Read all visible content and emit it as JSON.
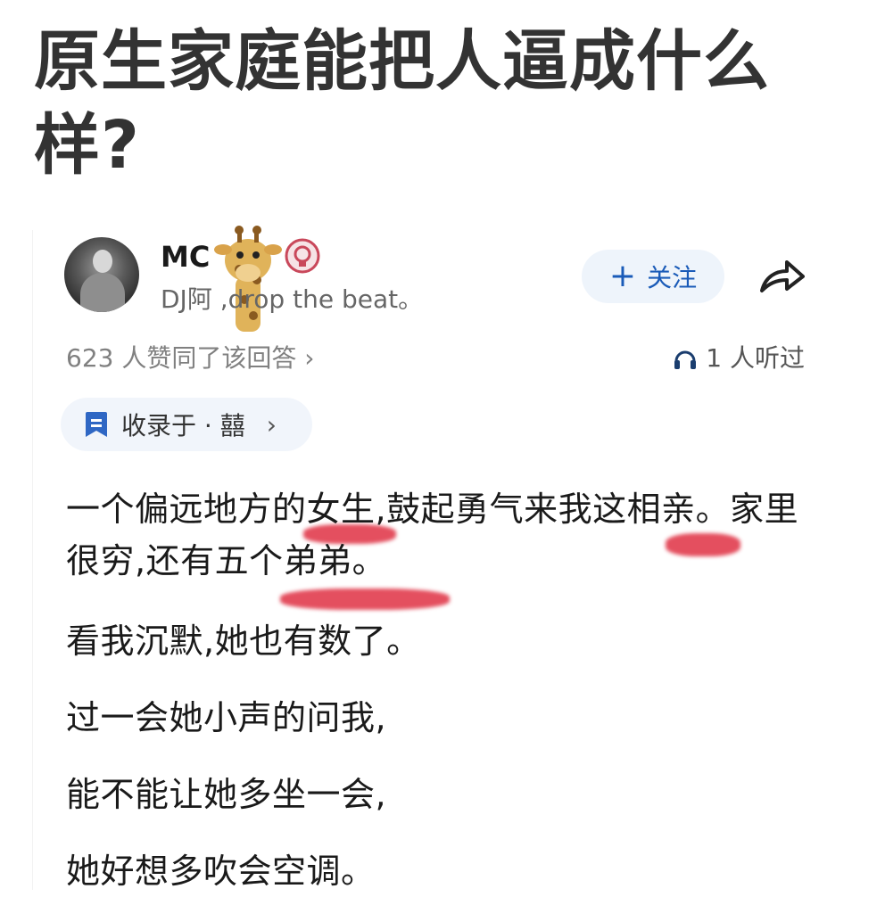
{
  "question": {
    "title": "原生家庭能把人逼成什么样?"
  },
  "author": {
    "name": "MC",
    "bio": "DJ阿 ,drop the beat。"
  },
  "actions": {
    "follow_label": "关注",
    "follow_icon": "plus-icon",
    "share_icon": "share-icon"
  },
  "stats": {
    "likes_text": "623 人赞同了该回答 ›",
    "listen_text": "1 人听过",
    "listen_icon": "headphones-icon"
  },
  "collection": {
    "label": "收录于 · 囍",
    "chevron": "›",
    "icon": "bookmark-icon"
  },
  "answer": {
    "paragraphs": [
      "一个偏远地方的女生,鼓起勇气来我这相亲。家里很穷,还有五个弟弟。",
      "看我沉默,她也有数了。",
      "过一会她小声的问我,",
      "能不能让她多坐一会,",
      "她好想多吹会空调。"
    ]
  },
  "colors": {
    "title": "#333333",
    "accent_blue": "#1a5bb8",
    "chip_bg": "#f1f5fb",
    "highlight_red": "#dc1e32"
  }
}
